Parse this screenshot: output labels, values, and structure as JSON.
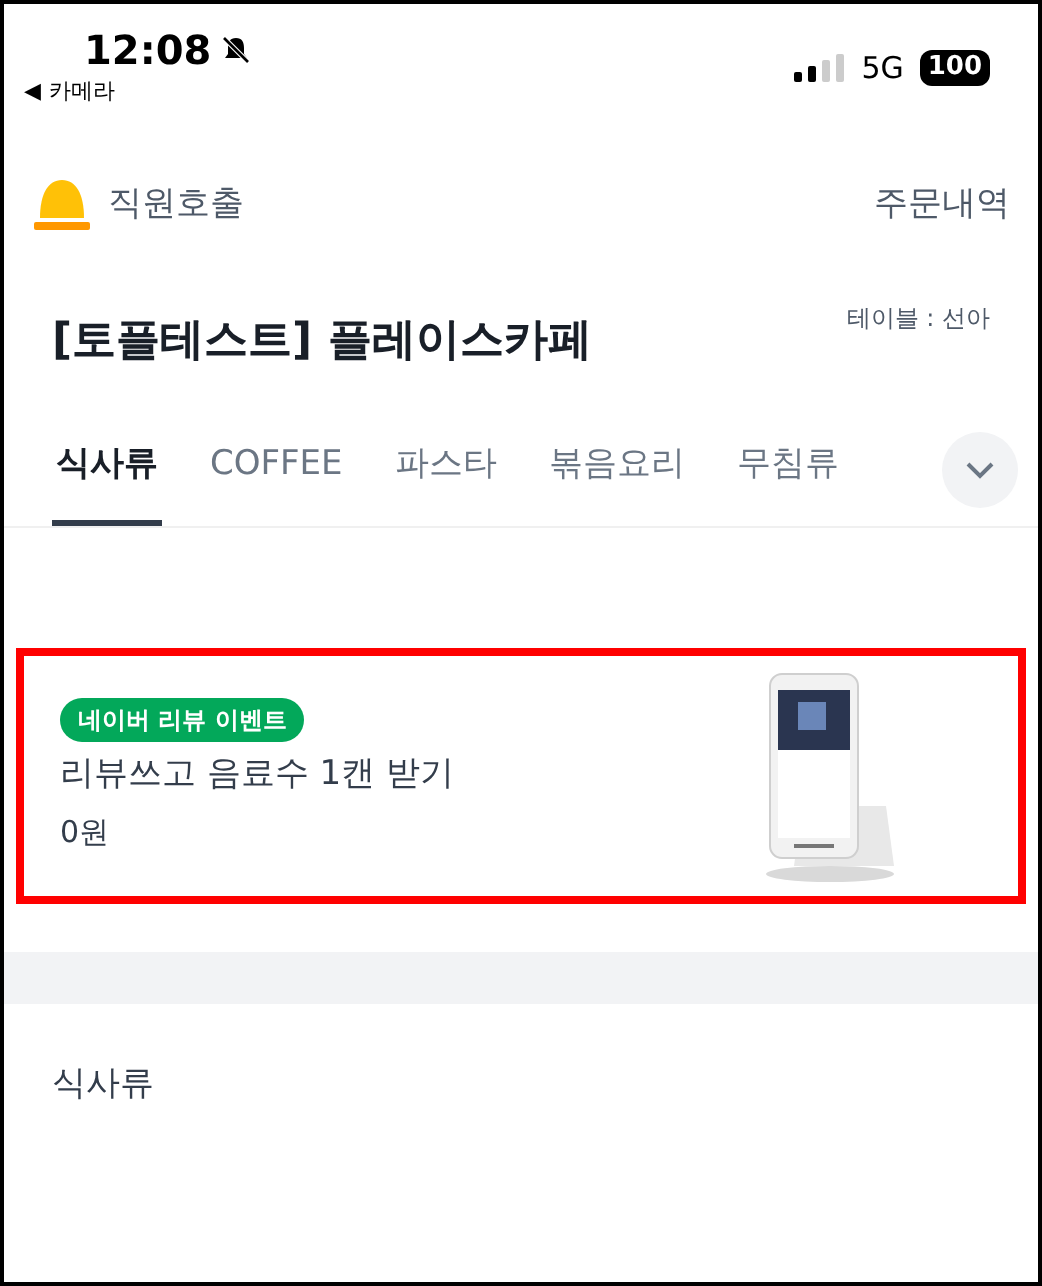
{
  "status_bar": {
    "time": "12:08",
    "back": "◀",
    "back_app": "카메라",
    "network": "5G",
    "battery": "100"
  },
  "header": {
    "call_staff": "직원호출",
    "order_history": "주문내역"
  },
  "store": {
    "name": "[토플테스트] 플레이스카페",
    "table": "테이블 : 선아"
  },
  "tabs": [
    {
      "label": "식사류",
      "selected": true
    },
    {
      "label": "COFFEE",
      "selected": false
    },
    {
      "label": "파스타",
      "selected": false
    },
    {
      "label": "볶음요리",
      "selected": false
    },
    {
      "label": "무침류",
      "selected": false
    }
  ],
  "promo": {
    "badge": "네이버 리뷰 이벤트",
    "title": "리뷰쓰고 음료수 1캔 받기",
    "price": "0원",
    "highlighted": true
  },
  "section": {
    "title": "식사류"
  }
}
